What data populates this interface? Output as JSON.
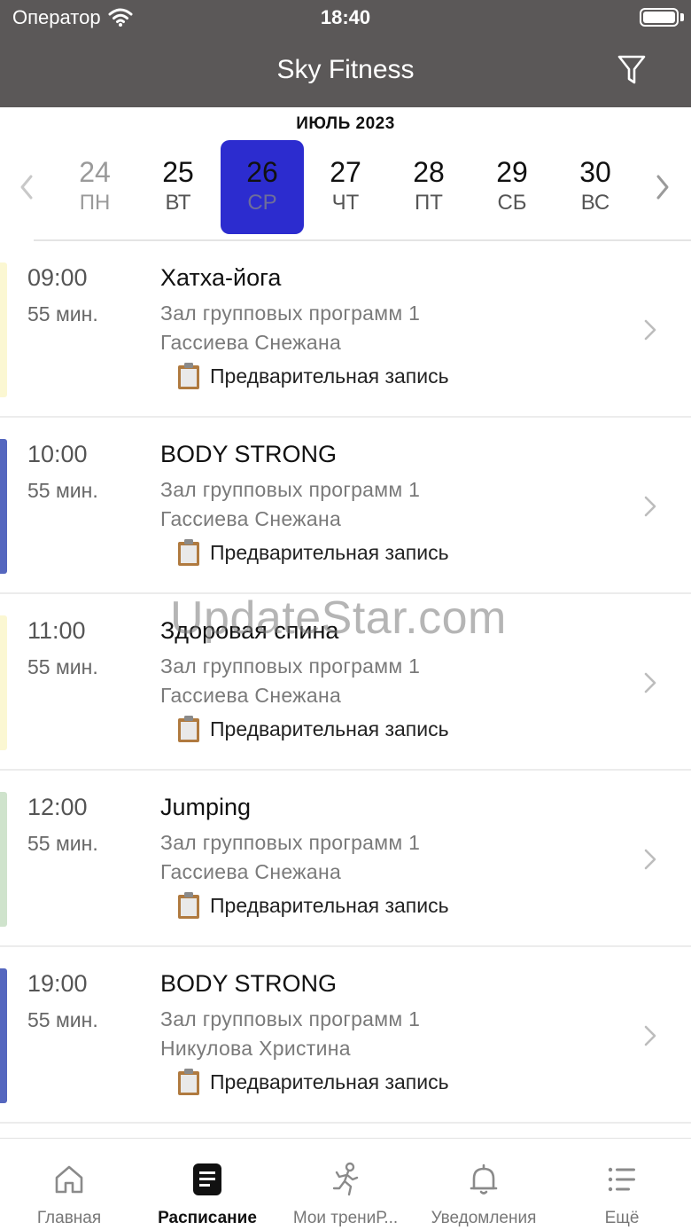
{
  "status": {
    "carrier": "Оператор",
    "time": "18:40"
  },
  "nav": {
    "title": "Sky Fitness"
  },
  "calendar": {
    "month": "ИЮЛЬ 2023",
    "days": [
      {
        "num": "24",
        "dow": "ПН"
      },
      {
        "num": "25",
        "dow": "ВТ"
      },
      {
        "num": "26",
        "dow": "СР"
      },
      {
        "num": "27",
        "dow": "ЧТ"
      },
      {
        "num": "28",
        "dow": "ПТ"
      },
      {
        "num": "29",
        "dow": "СБ"
      },
      {
        "num": "30",
        "dow": "ВС"
      }
    ]
  },
  "sessions": [
    {
      "time": "09:00",
      "duration": "55 мин.",
      "title": "Хатха-йога",
      "hall": "Зал групповых программ 1",
      "coach": "Гассиева Снежана",
      "booking": "Предварительная запись",
      "color": "#fbf7d2"
    },
    {
      "time": "10:00",
      "duration": "55 мин.",
      "title": "BODY STRONG",
      "hall": "Зал групповых программ 1",
      "coach": "Гассиева Снежана",
      "booking": "Предварительная запись",
      "color": "#5567bf"
    },
    {
      "time": "11:00",
      "duration": "55 мин.",
      "title": "Здоровая спина",
      "hall": "Зал групповых программ 1",
      "coach": "Гассиева Снежана",
      "booking": "Предварительная запись",
      "color": "#fbf7d2"
    },
    {
      "time": "12:00",
      "duration": "55 мин.",
      "title": "Jumping",
      "hall": "Зал групповых программ 1",
      "coach": "Гассиева Снежана",
      "booking": "Предварительная запись",
      "color": "#cfe3cc"
    },
    {
      "time": "19:00",
      "duration": "55 мин.",
      "title": "BODY STRONG",
      "hall": "Зал групповых программ 1",
      "coach": "Никулова Христина",
      "booking": "Предварительная запись",
      "color": "#5567bf"
    }
  ],
  "watermark": "UpdateStar.com",
  "tabs": [
    {
      "label": "Главная",
      "icon": "home-icon"
    },
    {
      "label": "Расписание",
      "icon": "schedule-icon"
    },
    {
      "label": "Мои трениР...",
      "icon": "runner-icon"
    },
    {
      "label": "Уведомления",
      "icon": "bell-icon"
    },
    {
      "label": "Ещё",
      "icon": "list-icon"
    }
  ]
}
